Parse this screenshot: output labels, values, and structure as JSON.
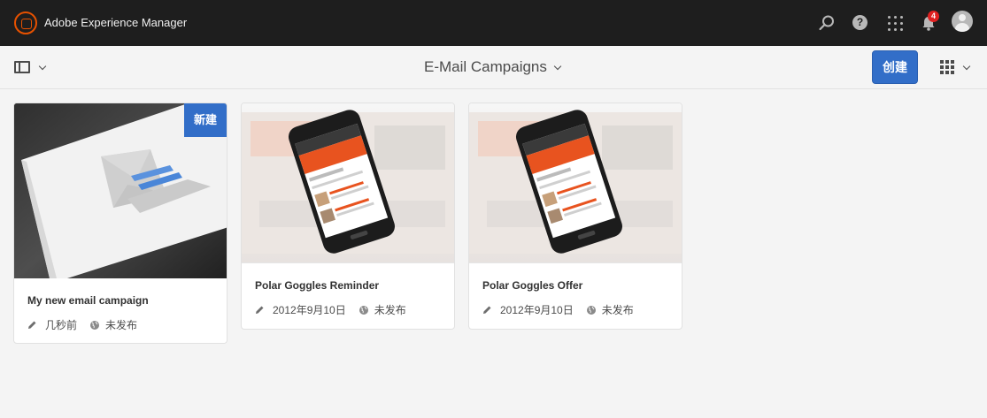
{
  "shell": {
    "app_title": "Adobe Experience Manager",
    "notification_count": "4",
    "help_glyph": "?",
    "icons": [
      "adobe-logo-icon",
      "search-icon",
      "help-icon",
      "apps-icon",
      "bell-icon",
      "avatar"
    ]
  },
  "actionbar": {
    "title": "E-Mail Campaigns",
    "create_label": "创建",
    "icons": [
      "rail-toggle-icon",
      "view-switcher-icon"
    ]
  },
  "cards": [
    {
      "title": "My new email campaign",
      "tag": "新建",
      "modified": "几秒前",
      "status": "未发布"
    },
    {
      "title": "Polar Goggles Reminder",
      "modified": "2012年9月10日",
      "status": "未发布"
    },
    {
      "title": "Polar Goggles Offer",
      "modified": "2012年9月10日",
      "status": "未发布"
    }
  ],
  "colors": {
    "shell_bg": "#1e1e1e",
    "accent": "#326ec8",
    "logo": "#e65100",
    "badge": "#e02020"
  }
}
